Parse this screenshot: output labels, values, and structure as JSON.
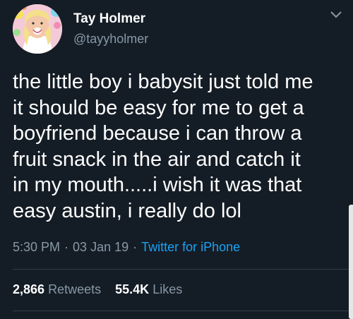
{
  "author": {
    "display_name": "Tay Holmer",
    "handle": "@tayyholmer"
  },
  "tweet": {
    "lines": [
      "the little boy i babysit just told me",
      "it should be easy for me to get a",
      "boyfriend because i can throw a",
      "fruit snack in the air and catch it",
      "in my mouth.....i wish it was that",
      "easy austin, i really do lol"
    ],
    "time": "5:30 PM",
    "date": "03 Jan 19",
    "source": "Twitter for iPhone",
    "separator": "·"
  },
  "stats": {
    "retweets_count": "2,866",
    "retweets_label": "Retweets",
    "likes_count": "55.4K",
    "likes_label": "Likes"
  },
  "icons": {
    "menu": "chevron-down-icon"
  },
  "colors": {
    "background": "#141d26",
    "text": "#ffffff",
    "secondary": "#8899a6",
    "link": "#1da1f2",
    "divider": "#2f3d4a"
  }
}
